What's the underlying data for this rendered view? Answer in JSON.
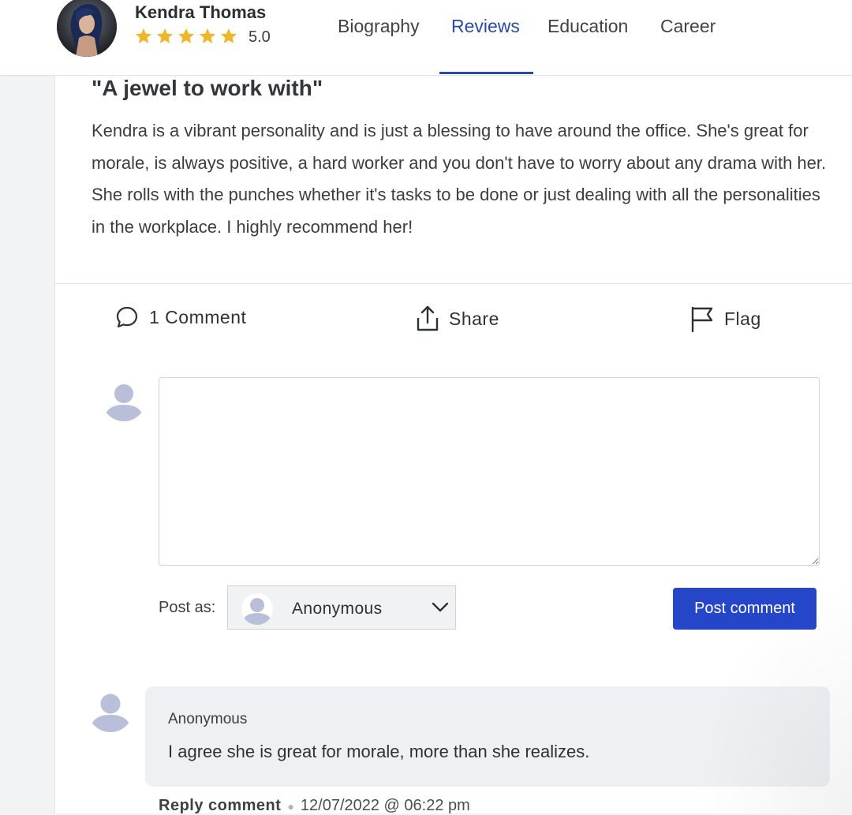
{
  "profile": {
    "name": "Kendra Thomas",
    "rating": "5.0",
    "stars": 5
  },
  "nav": {
    "tabs": [
      "Biography",
      "Reviews",
      "Education",
      "Career"
    ],
    "active": "Reviews"
  },
  "review": {
    "title": "\"A jewel to work with\"",
    "body": "Kendra is a vibrant personality and is just a blessing to have around the office. She's great for morale, is always positive, a hard worker and you don't have to worry about any drama with her. She rolls with the punches whether it's tasks to be done or just dealing with all the personalities in the workplace. I highly recommend her!"
  },
  "actions": {
    "comment_label": "1 Comment",
    "share_label": "Share",
    "flag_label": "Flag"
  },
  "form": {
    "comment_value": "",
    "post_as_label": "Post as:",
    "post_as_value": "Anonymous",
    "submit_label": "Post comment"
  },
  "comments": [
    {
      "author": "Anonymous",
      "text": "I agree she is great for morale, more than she realizes.",
      "reply_label": "Reply comment",
      "timestamp": "12/07/2022 @ 06:22 pm"
    }
  ],
  "colors": {
    "accent": "#2b4aa8",
    "button": "#2546c9",
    "star": "#f1b52a",
    "avatar_placeholder": "#b9bfd9"
  },
  "icons": {
    "star": "star-icon",
    "comment": "speech-bubble-icon",
    "share": "share-upload-icon",
    "flag": "flag-icon",
    "avatar": "user-silhouette-icon",
    "dropdown": "chevron-down-icon"
  }
}
